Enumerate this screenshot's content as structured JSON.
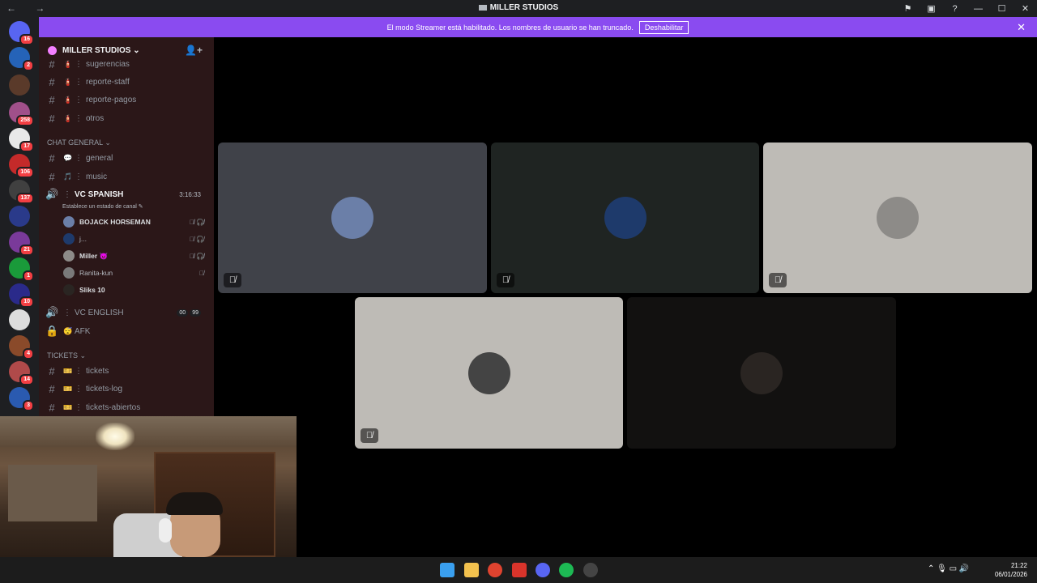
{
  "titlebar": {
    "title": "MILLER STUDIOS",
    "nav": "← →",
    "icons": [
      "flag-icon",
      "window-icon",
      "help-icon",
      "minimize-icon",
      "maximize-icon",
      "close-icon"
    ],
    "glyphs": {
      "flag": "⚑",
      "window": "▣",
      "help": "?",
      "minimize": "—",
      "maximize": "☐",
      "close": "✕"
    }
  },
  "banner": {
    "text": "El modo Streamer está habilitado. Los nombres de usuario se han truncado.",
    "button_label": "Deshabilitar",
    "close": "✕",
    "color": "#8a4bf0"
  },
  "guilds": {
    "badges": [
      "16",
      "2",
      "258",
      "17",
      "106",
      "137",
      "21",
      "1",
      "10",
      "4",
      "14",
      "3"
    ]
  },
  "server": {
    "name": "MILLER STUDIOS ⌄",
    "add_icon": "👤+"
  },
  "channels": {
    "top": [
      {
        "name": "sugerencias",
        "emoji": "🧯"
      },
      {
        "name": "reporte-staff",
        "emoji": "🧯"
      },
      {
        "name": "reporte-pagos",
        "emoji": "🧯"
      },
      {
        "name": "otros",
        "emoji": "🧯"
      }
    ],
    "category_chat": "CHAT GENERAL ⌄",
    "chat": [
      {
        "name": "general",
        "emoji": "💬"
      },
      {
        "name": "music",
        "emoji": "🎵"
      }
    ],
    "voice_active": {
      "name": "VC SPANISH",
      "timer": "3:16:33",
      "status": "Establece un estado de canal ✎",
      "users": [
        {
          "name": "BOJACK HORSEMAN",
          "icons": "🎙̸ 🎧̸"
        },
        {
          "name": "j...",
          "icons": "🎙̸ 🎧̸"
        },
        {
          "name": "Miller 😈",
          "icons": "🎙̸ 🎧̸"
        },
        {
          "name": "Ranita-kun",
          "icons": "🎙̸"
        },
        {
          "name": "Sliks 10",
          "icons": ""
        }
      ]
    },
    "voice_english": {
      "name": "VC ENGLISH",
      "counts": [
        "00",
        "99"
      ]
    },
    "afk": {
      "name": "AFK",
      "emoji": "😴"
    },
    "category_tickets": "TICKETS ⌄",
    "tickets": [
      {
        "name": "tickets",
        "emoji": "🎫"
      },
      {
        "name": "tickets-log",
        "emoji": "🎫"
      },
      {
        "name": "tickets-abiertos",
        "emoji": "🎫"
      }
    ]
  },
  "tiles": [
    {
      "bg": "#404249",
      "avatar": "#6b7fa8",
      "muted": true
    },
    {
      "bg": "#1f2422",
      "avatar": "#1e3a6b",
      "muted": true
    },
    {
      "bg": "#bebbb6",
      "avatar": "#8d8b88",
      "muted": true
    },
    {
      "bg": "#bebbb6",
      "avatar": "#444",
      "muted": true
    },
    {
      "bg": "#121110",
      "avatar": "#2a2522",
      "muted": false
    }
  ],
  "taskbar": {
    "time": "21:22",
    "date": "06/01/2026",
    "tray": "⌃   🎙   ▭   🔊"
  }
}
